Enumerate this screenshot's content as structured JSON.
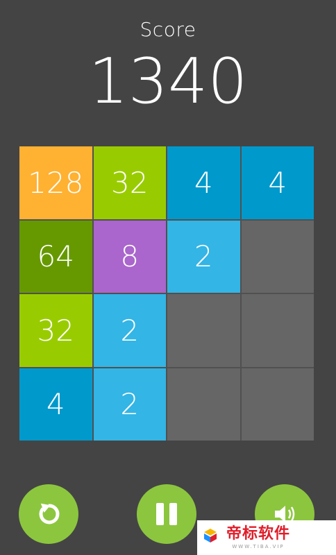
{
  "header": {
    "score_label": "Score",
    "score_value": "1340"
  },
  "board": {
    "rows": [
      [
        {
          "value": "128",
          "color": "#ffb132"
        },
        {
          "value": "32",
          "color": "#99cc00"
        },
        {
          "value": "4",
          "color": "#0099cc"
        },
        {
          "value": "4",
          "color": "#0099cc"
        }
      ],
      [
        {
          "value": "64",
          "color": "#669900"
        },
        {
          "value": "8",
          "color": "#aa66cc"
        },
        {
          "value": "2",
          "color": "#33b5e5"
        },
        {
          "value": "",
          "color": "#666666"
        }
      ],
      [
        {
          "value": "32",
          "color": "#99cc00"
        },
        {
          "value": "2",
          "color": "#33b5e5"
        },
        {
          "value": "",
          "color": "#666666"
        },
        {
          "value": "",
          "color": "#666666"
        }
      ],
      [
        {
          "value": "4",
          "color": "#0099cc"
        },
        {
          "value": "2",
          "color": "#33b5e5"
        },
        {
          "value": "",
          "color": "#666666"
        },
        {
          "value": "",
          "color": "#666666"
        }
      ]
    ]
  },
  "controls": {
    "restart_icon": "restart-icon",
    "pause_icon": "pause-icon",
    "sound_icon": "sound-icon",
    "button_color": "#8cc63f"
  },
  "watermark": {
    "brand": "帝标软件",
    "url": "WWW.TIBA.VIP"
  }
}
